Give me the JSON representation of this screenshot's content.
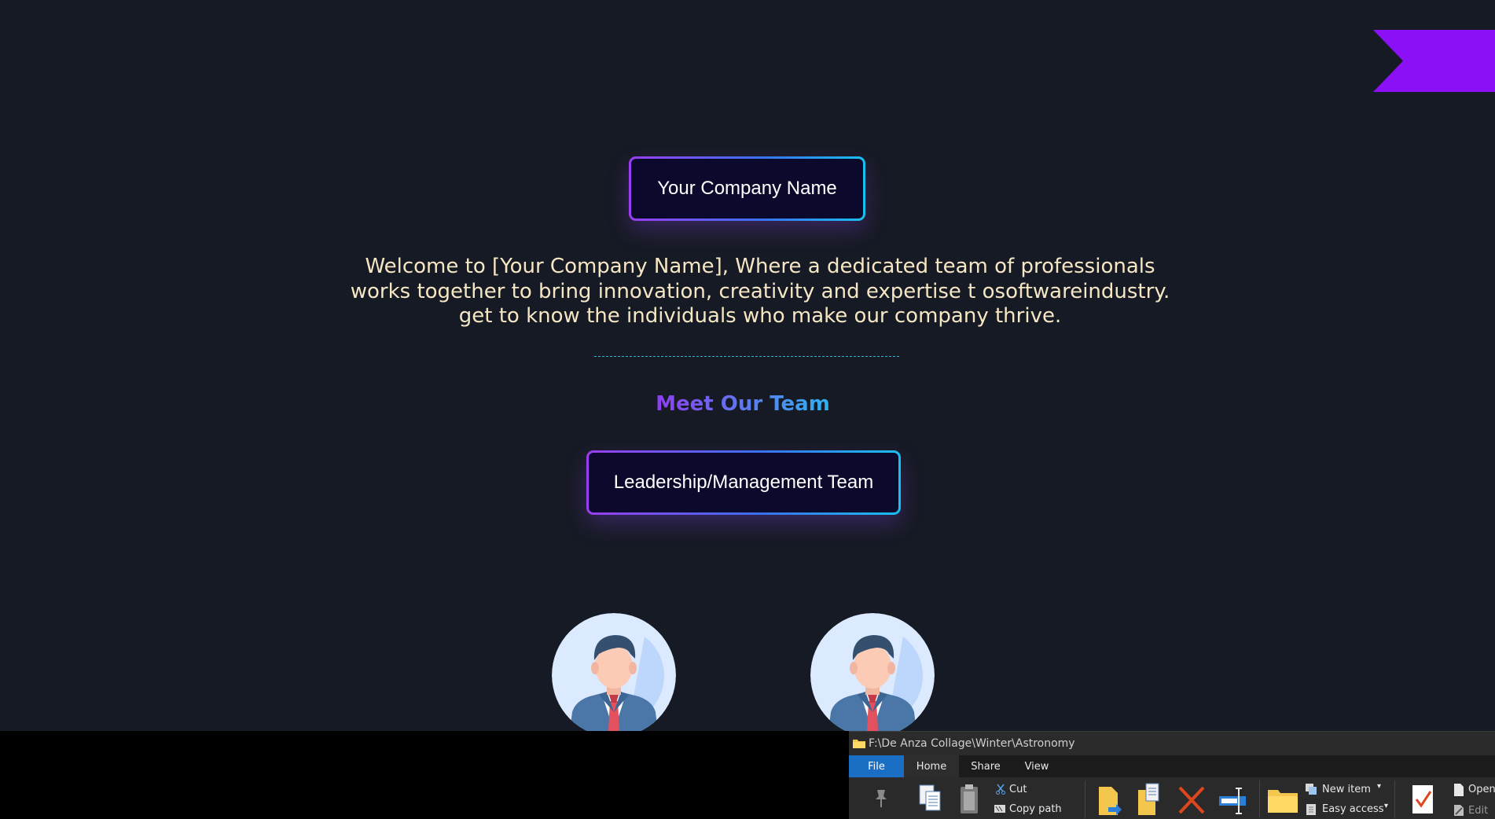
{
  "page": {
    "company_button": "Your Company Name",
    "welcome_text": "Welcome to [Your Company Name], Where a dedicated team of professionals works together to bring innovation, creativity and expertise t osoftwareindustry. get to know the individuals who make our company thrive.",
    "team_heading": "Meet Our Team",
    "leadership_button": "Leadership/Management Team"
  },
  "colors": {
    "background": "#161a24",
    "ribbon_flag": "#8c10f5",
    "welcome_text": "#f6e7c4",
    "gradient_start": "#9a3df0",
    "gradient_end": "#18c0ef",
    "button_fill": "#0b0a2c",
    "divider": "#2fb6d6"
  },
  "explorer": {
    "title": "F:\\De Anza Collage\\Winter\\Astronomy",
    "tabs": [
      "File",
      "Home",
      "Share",
      "View"
    ],
    "ribbon": {
      "cut": "Cut",
      "copy_path": "Copy path",
      "new_item": "New item",
      "easy_access": "Easy access",
      "open": "Open",
      "edit": "Edit"
    }
  }
}
